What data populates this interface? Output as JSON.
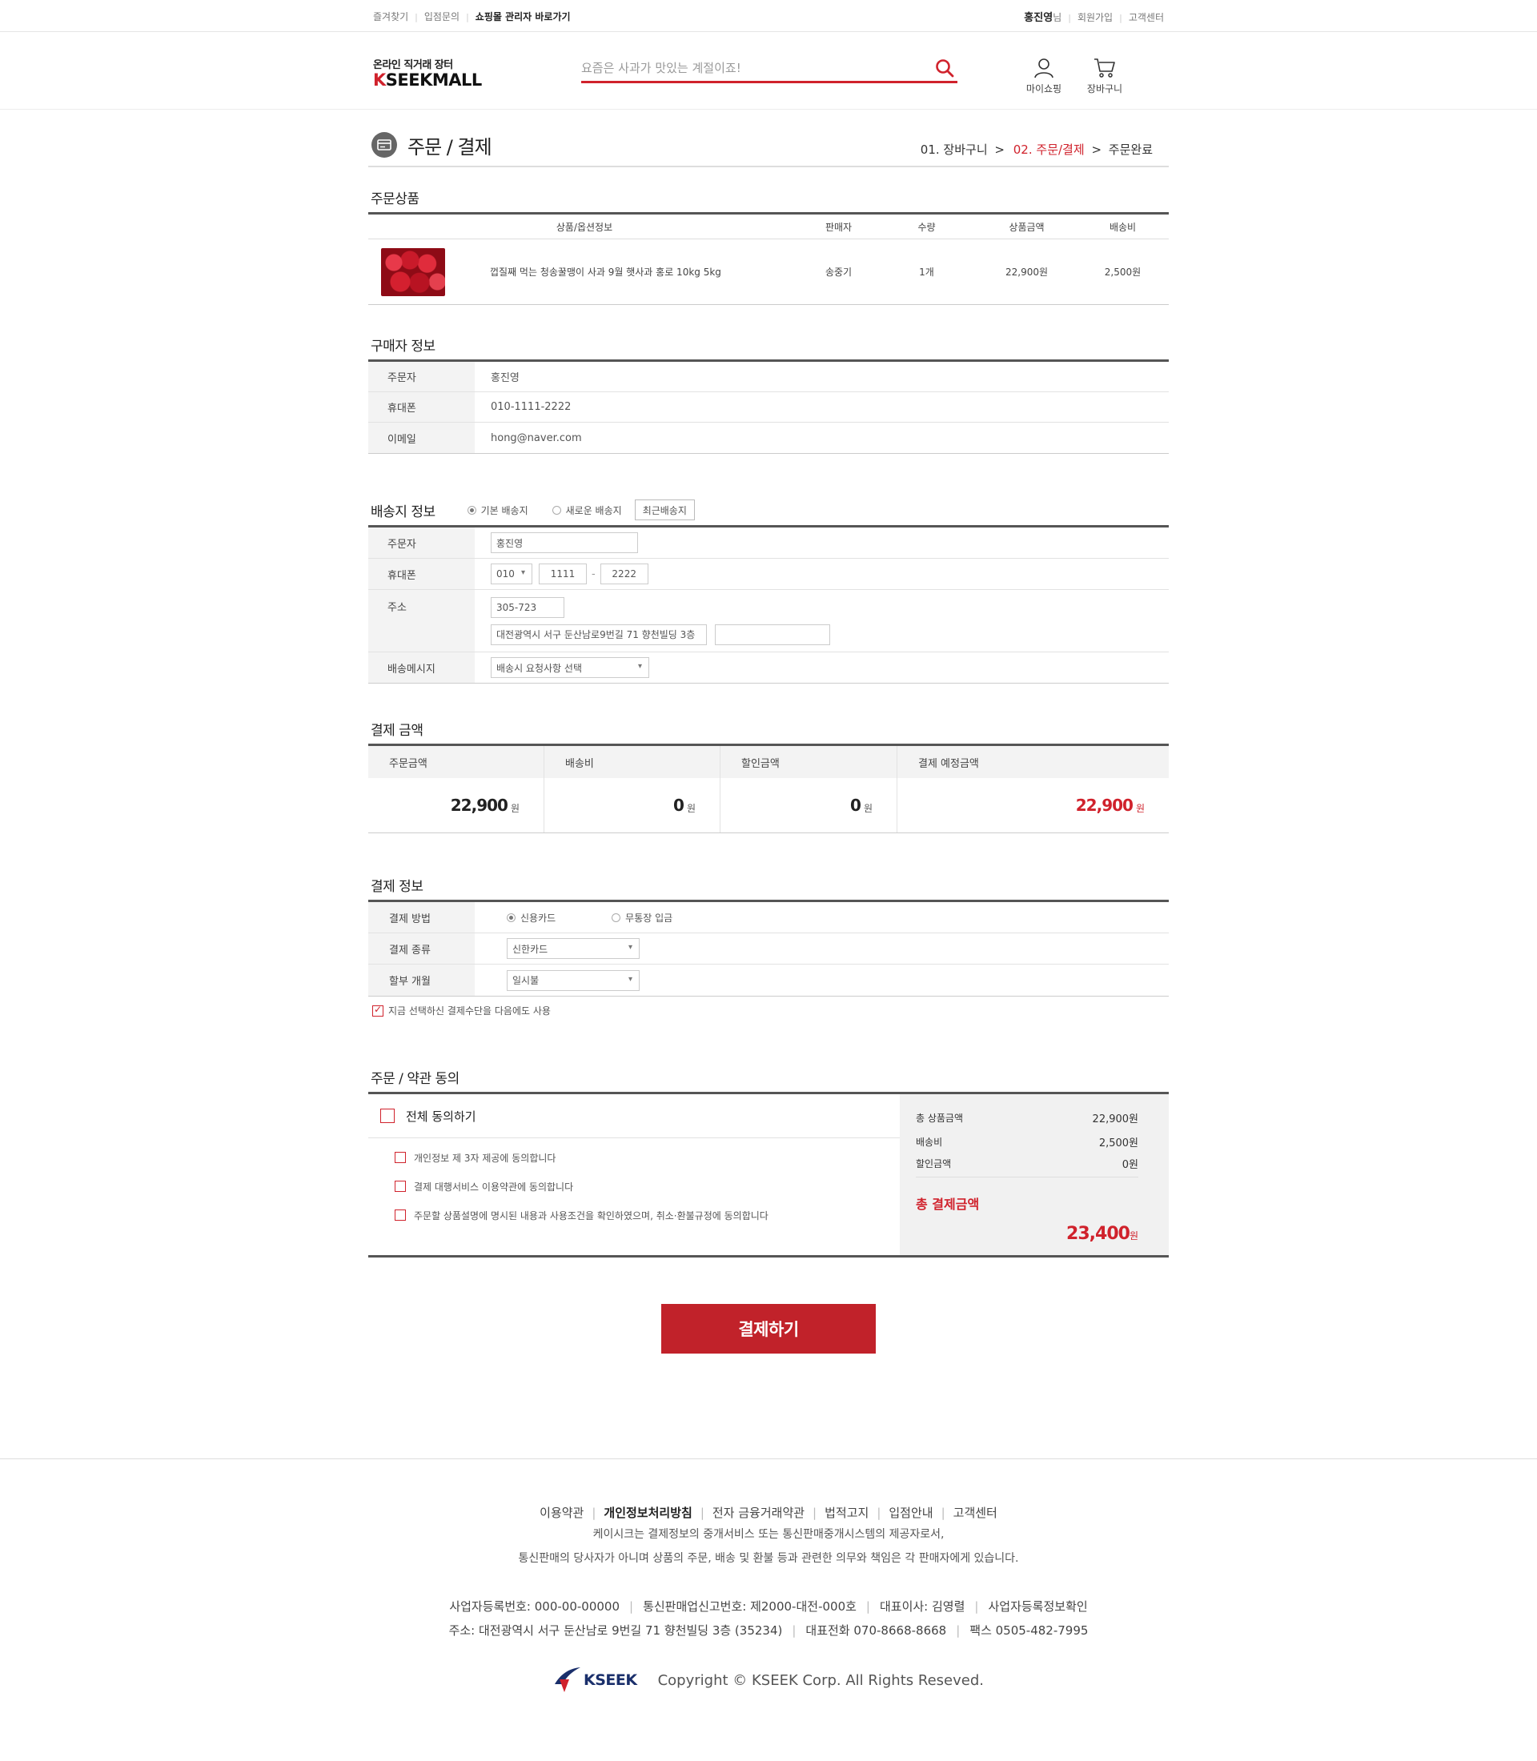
{
  "topbar": {
    "left": [
      "즐겨찾기",
      "입점문의",
      "쇼핑몰 관리자 바로가기"
    ],
    "user_name": "홍진영",
    "user_suffix": "님",
    "right": [
      "회원가입",
      "고객센터"
    ]
  },
  "header": {
    "logo_tagline": "온라인 직거래 장터",
    "logo_k": "K",
    "logo_rest": "SEEKMALL",
    "search_placeholder": "요즘은 사과가 맛있는 계절이죠!",
    "mypage_label": "마이쇼핑",
    "cart_label": "장바구니"
  },
  "page": {
    "title": "주문 / 결제",
    "steps": {
      "step1": "01. 장바구니",
      "arrow": ">",
      "step2": "02. 주문/결제",
      "step3": "주문완료"
    }
  },
  "order_products": {
    "title": "주문상품",
    "headers": [
      "상품/옵션정보",
      "판매자",
      "수량",
      "상품금액",
      "배송비"
    ],
    "rows": [
      {
        "name": "껍질째 먹는 청송꿀맹이 사과 9월 햇사과 홍로 10kg 5kg",
        "seller": "송중기",
        "qty": "1개",
        "price": "22,900원",
        "shipping": "2,500원"
      }
    ]
  },
  "buyer": {
    "title": "구매자 정보",
    "rows": [
      {
        "label": "주문자",
        "value": "홍진영"
      },
      {
        "label": "휴대폰",
        "value": "010-1111-2222"
      },
      {
        "label": "이메일",
        "value": "hong@naver.com"
      }
    ]
  },
  "shipping": {
    "title": "배송지 정보",
    "opt_default": "기본 배송지",
    "opt_new": "새로운 배송지",
    "recent_btn": "최근배송지",
    "name_label": "주문자",
    "name_value": "홍진영",
    "phone_label": "휴대폰",
    "phone1": "010",
    "phone2": "1111",
    "phone_dash": "-",
    "phone3": "2222",
    "addr_label": "주소",
    "zip": "305-723",
    "addr1": "대전광역시 서구 둔산남로9번길 71 향천빌딩 3층",
    "addr2": "",
    "msg_label": "배송메시지",
    "msg_select": "배송시 요청사항 선택"
  },
  "payment_amount": {
    "title": "결제 금액",
    "cols": [
      {
        "label": "주문금액",
        "value": "22,900",
        "unit": "원"
      },
      {
        "label": "배송비",
        "value": "0",
        "unit": "원"
      },
      {
        "label": "할인금액",
        "value": "0",
        "unit": "원"
      },
      {
        "label": "결제 예정금액",
        "value": "22,900",
        "unit": "원"
      }
    ]
  },
  "payment_info": {
    "title": "결제 정보",
    "method_label": "결제 방법",
    "method_card": "신용카드",
    "method_bank": "무통장 입금",
    "type_label": "결제 종류",
    "type_value": "신한카드",
    "installment_label": "할부 개월",
    "installment_value": "일시불",
    "save_label": "지금 선택하신 결제수단을 다음에도 사용"
  },
  "agreement": {
    "title": "주문 / 약관 동의",
    "all": "전체 동의하기",
    "items": [
      "개인정보 제 3자 제공에 동의합니다",
      "결제 대행서비스 이용약관에 동의합니다",
      "주문할 상품설명에 명시된 내용과 사용조건을 확인하였으며, 취소·환불규정에 동의합니다"
    ],
    "summary": {
      "product_label": "총 상품금액",
      "product_value": "22,900원",
      "ship_label": "배송비",
      "ship_value": "2,500원",
      "discount_label": "할인금액",
      "discount_value": "0원",
      "total_label": "총 결제금액",
      "total_value": "23,400",
      "total_unit": "원"
    }
  },
  "pay_button": "결제하기",
  "footer": {
    "links": [
      "이용약관",
      "개인정보처리방침",
      "전자 금융거래약관",
      "법적고지",
      "입점안내",
      "고객센터"
    ],
    "desc1": "케이시크는 결제정보의 중개서비스 또는 통신판매중개시스템의 제공자로서,",
    "desc2": "통신판매의 당사자가 아니며 상품의 주문, 배송 및 환불 등과 관련한 의무와 책임은 각 판매자에게 있습니다.",
    "info1": [
      "사업자등록번호: 000-00-00000",
      "통신판매업신고번호: 제2000-대전-000호",
      "대표이사: 김영렬",
      "사업자등록정보확인"
    ],
    "info2": [
      "주소: 대전광역시 서구 둔산남로 9번길 71 향천빌딩 3층 (35234)",
      "대표전화 070-8668-8668",
      "팩스 0505-482-7995"
    ],
    "brand": "KSEEK",
    "copyright": "Copyright © KSEEK Corp. All Rights Reseved."
  },
  "colors": {
    "accent": "#d0222c",
    "button": "#c1222a",
    "border_dark": "#555555",
    "header_bg": "#f3f3f3"
  }
}
